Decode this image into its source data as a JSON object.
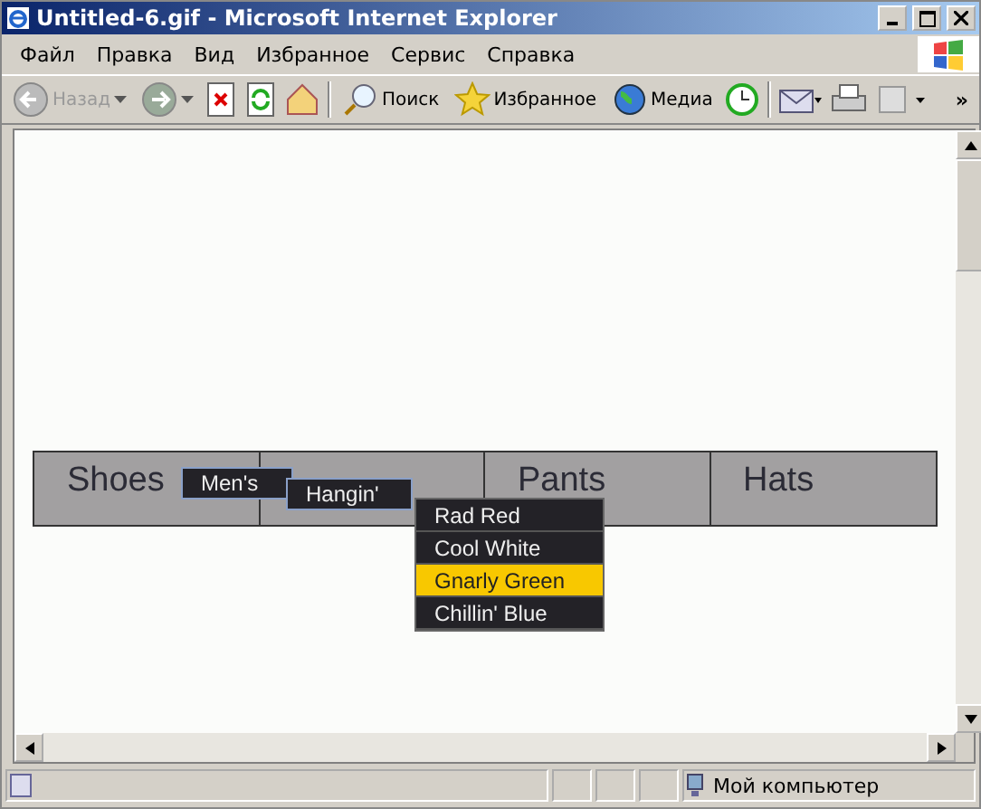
{
  "window": {
    "title": "Untitled-6.gif - Microsoft Internet Explorer"
  },
  "menu_bar": [
    "Файл",
    "Правка",
    "Вид",
    "Избранное",
    "Сервис",
    "Справка"
  ],
  "toolbar": [
    {
      "kind": "nav",
      "label": "Назад",
      "disabled": true
    },
    {
      "kind": "nav",
      "disabled": false
    },
    {
      "kind": "icon"
    },
    {
      "kind": "icon"
    },
    {
      "kind": "icon"
    },
    {
      "kind": "sep"
    },
    {
      "kind": "labeled",
      "label": "Поиск"
    },
    {
      "kind": "labeled",
      "label": "Избранное"
    },
    {
      "kind": "labeled",
      "label": "Медиа"
    },
    {
      "kind": "icon"
    },
    {
      "kind": "sep"
    },
    {
      "kind": "icon"
    },
    {
      "kind": "icon"
    },
    {
      "kind": "icon"
    }
  ],
  "toolbar_overflow": "»",
  "nav": [
    {
      "kind": "text",
      "label": "Shoes"
    },
    {
      "kind": "blank"
    },
    {
      "kind": "text",
      "label": "Pants"
    },
    {
      "kind": "text",
      "label": "Hats"
    }
  ],
  "submenu_1": {
    "label": "Men's"
  },
  "submenu_2": {
    "label": "Hangin'"
  },
  "color_menu": [
    {
      "label": "Rad Red",
      "selected": false
    },
    {
      "label": "Cool White",
      "selected": false
    },
    {
      "label": "Gnarly Green",
      "selected": true
    },
    {
      "label": "Chillin' Blue",
      "selected": false
    }
  ],
  "status_bar": {
    "zone": "Мой компьютер"
  }
}
